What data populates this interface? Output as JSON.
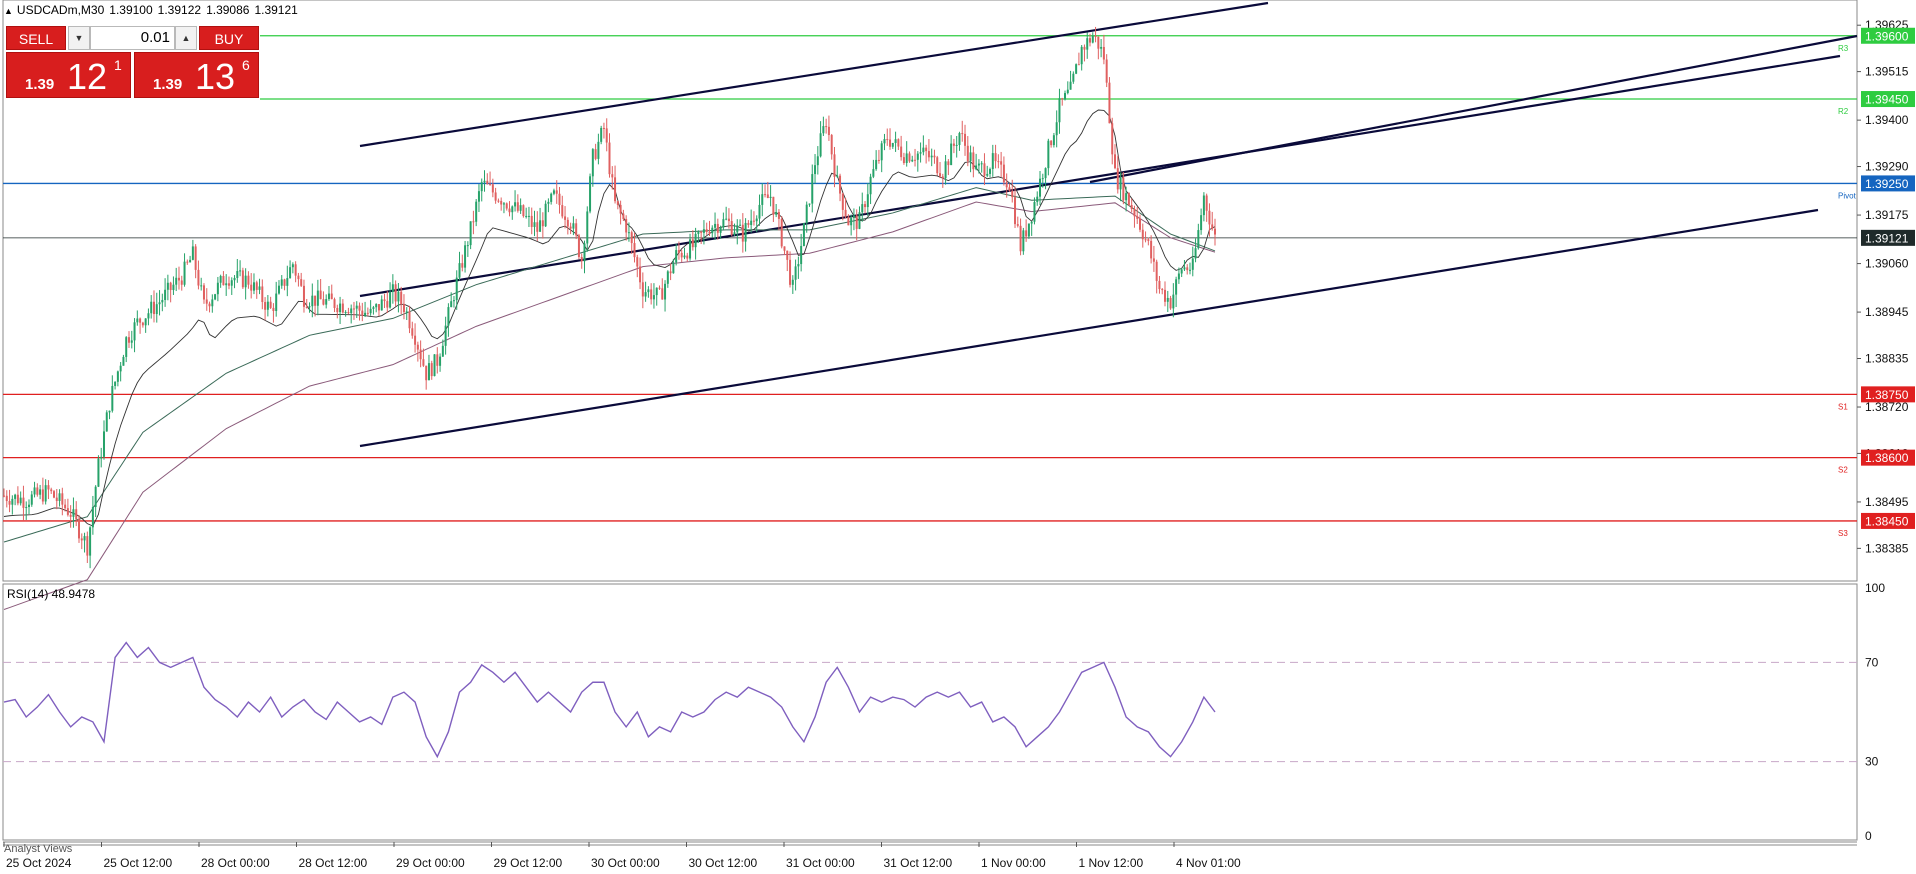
{
  "header": {
    "symbol": "USDCADm,M30",
    "ohlc": [
      "1.39100",
      "1.39122",
      "1.39086",
      "1.39121"
    ]
  },
  "trade_panel": {
    "sell_label": "SELL",
    "buy_label": "BUY",
    "lot_value": "0.01",
    "sell_price_small": "1.39",
    "sell_price_big": "12",
    "sell_price_sup": "1",
    "buy_price_small": "1.39",
    "buy_price_big": "13",
    "buy_price_sup": "6"
  },
  "rsi_label": "RSI(14) 48.9478",
  "footer_label": "Analyst Views",
  "colors": {
    "bull": "#26a269",
    "bear": "#e06060",
    "resistance": "#2ecc40",
    "support": "#e02020",
    "pivot": "#1565c0",
    "current": "#1f2a2a",
    "rsi": "#7f5fbf",
    "channel": "#0a0a3a"
  },
  "chart_data": [
    {
      "type": "candlestick",
      "symbol": "USDCADm",
      "timeframe": "M30",
      "ylim": [
        1.3831,
        1.3968
      ],
      "y_ticks": [
        1.39625,
        1.39515,
        1.394,
        1.3929,
        1.39175,
        1.3906,
        1.38945,
        1.38835,
        1.3872,
        1.3861,
        1.38495,
        1.38385
      ],
      "x_ticks": [
        "25 Oct 2024",
        "25 Oct 12:00",
        "28 Oct 00:00",
        "28 Oct 12:00",
        "29 Oct 00:00",
        "29 Oct 12:00",
        "30 Oct 00:00",
        "30 Oct 12:00",
        "31 Oct 00:00",
        "31 Oct 12:00",
        "1 Nov 00:00",
        "1 Nov 12:00",
        "4 Nov 01:00"
      ],
      "horizontal_levels": [
        {
          "label": "R3",
          "value": 1.396,
          "tag": "1.39600",
          "kind": "resistance"
        },
        {
          "label": "R2",
          "value": 1.3945,
          "tag": "1.39450",
          "kind": "resistance"
        },
        {
          "label": "Pivot",
          "value": 1.3925,
          "tag": "1.39250",
          "kind": "pivot"
        },
        {
          "label": "",
          "value": 1.39121,
          "tag": "1.39121",
          "kind": "current"
        },
        {
          "label": "S1",
          "value": 1.3875,
          "tag": "1.38750",
          "kind": "support"
        },
        {
          "label": "S2",
          "value": 1.386,
          "tag": "1.38600",
          "kind": "support"
        },
        {
          "label": "S3",
          "value": 1.3845,
          "tag": "1.38450",
          "kind": "support"
        }
      ],
      "close_path": [
        [
          0,
          1.3851
        ],
        [
          8,
          1.385
        ],
        [
          16,
          1.3852
        ],
        [
          24,
          1.3847
        ],
        [
          30,
          1.3839
        ],
        [
          34,
          1.3858
        ],
        [
          38,
          1.3873
        ],
        [
          44,
          1.3888
        ],
        [
          48,
          1.3892
        ],
        [
          56,
          1.3897
        ],
        [
          64,
          1.3903
        ],
        [
          68,
          1.3908
        ],
        [
          72,
          1.3896
        ],
        [
          80,
          1.3903
        ],
        [
          88,
          1.3902
        ],
        [
          96,
          1.3895
        ],
        [
          104,
          1.3906
        ],
        [
          108,
          1.3898
        ],
        [
          116,
          1.3897
        ],
        [
          124,
          1.3896
        ],
        [
          132,
          1.3894
        ],
        [
          140,
          1.3899
        ],
        [
          144,
          1.3896
        ],
        [
          148,
          1.3889
        ],
        [
          152,
          1.388
        ],
        [
          156,
          1.3883
        ],
        [
          162,
          1.3899
        ],
        [
          168,
          1.3914
        ],
        [
          172,
          1.3925
        ],
        [
          178,
          1.3922
        ],
        [
          186,
          1.3918
        ],
        [
          192,
          1.3914
        ],
        [
          198,
          1.3922
        ],
        [
          204,
          1.3916
        ],
        [
          208,
          1.3907
        ],
        [
          212,
          1.3931
        ],
        [
          216,
          1.3938
        ],
        [
          220,
          1.392
        ],
        [
          224,
          1.3915
        ],
        [
          230,
          1.39
        ],
        [
          236,
          1.3898
        ],
        [
          242,
          1.3908
        ],
        [
          248,
          1.391
        ],
        [
          254,
          1.3915
        ],
        [
          260,
          1.3916
        ],
        [
          266,
          1.3913
        ],
        [
          272,
          1.392
        ],
        [
          276,
          1.3922
        ],
        [
          280,
          1.3912
        ],
        [
          284,
          1.39
        ],
        [
          288,
          1.3914
        ],
        [
          292,
          1.393
        ],
        [
          296,
          1.394
        ],
        [
          300,
          1.3925
        ],
        [
          304,
          1.3916
        ],
        [
          308,
          1.3916
        ],
        [
          312,
          1.3926
        ],
        [
          318,
          1.3936
        ],
        [
          324,
          1.3932
        ],
        [
          328,
          1.3932
        ],
        [
          332,
          1.3932
        ],
        [
          338,
          1.3928
        ],
        [
          344,
          1.3937
        ],
        [
          350,
          1.3928
        ],
        [
          356,
          1.393
        ],
        [
          362,
          1.3925
        ],
        [
          366,
          1.391
        ],
        [
          370,
          1.3918
        ],
        [
          374,
          1.3928
        ],
        [
          380,
          1.3943
        ],
        [
          384,
          1.3947
        ],
        [
          388,
          1.3957
        ],
        [
          392,
          1.396
        ],
        [
          394,
          1.3958
        ],
        [
          396,
          1.3955
        ],
        [
          400,
          1.3927
        ],
        [
          404,
          1.3922
        ],
        [
          408,
          1.3917
        ],
        [
          412,
          1.391
        ],
        [
          416,
          1.39
        ],
        [
          420,
          1.3897
        ],
        [
          424,
          1.3905
        ],
        [
          428,
          1.3905
        ],
        [
          432,
          1.3922
        ],
        [
          436,
          1.3912
        ]
      ],
      "ma_path": [
        [
          0,
          1.384
        ],
        [
          30,
          1.3846
        ],
        [
          50,
          1.3866
        ],
        [
          80,
          1.388
        ],
        [
          110,
          1.3889
        ],
        [
          140,
          1.3893
        ],
        [
          170,
          1.3901
        ],
        [
          200,
          1.3907
        ],
        [
          230,
          1.3913
        ],
        [
          260,
          1.3914
        ],
        [
          290,
          1.3914
        ],
        [
          320,
          1.3918
        ],
        [
          350,
          1.3924
        ],
        [
          370,
          1.3921
        ],
        [
          400,
          1.3922
        ],
        [
          420,
          1.3913
        ],
        [
          436,
          1.3909
        ]
      ]
    },
    {
      "type": "line",
      "title": "RSI(14)",
      "value": 48.9478,
      "ylim": [
        0,
        100
      ],
      "y_ticks": [
        100,
        70,
        30,
        0
      ],
      "levels": [
        70,
        30
      ],
      "rsi_path": [
        [
          0,
          54
        ],
        [
          4,
          55
        ],
        [
          8,
          48
        ],
        [
          12,
          52
        ],
        [
          16,
          57
        ],
        [
          20,
          50
        ],
        [
          24,
          44
        ],
        [
          28,
          48
        ],
        [
          32,
          46
        ],
        [
          36,
          38
        ],
        [
          40,
          72
        ],
        [
          44,
          78
        ],
        [
          48,
          72
        ],
        [
          52,
          76
        ],
        [
          56,
          70
        ],
        [
          60,
          68
        ],
        [
          64,
          70
        ],
        [
          68,
          72
        ],
        [
          72,
          60
        ],
        [
          76,
          55
        ],
        [
          80,
          52
        ],
        [
          84,
          48
        ],
        [
          88,
          54
        ],
        [
          92,
          50
        ],
        [
          96,
          56
        ],
        [
          100,
          48
        ],
        [
          104,
          52
        ],
        [
          108,
          55
        ],
        [
          112,
          50
        ],
        [
          116,
          47
        ],
        [
          120,
          54
        ],
        [
          124,
          50
        ],
        [
          128,
          46
        ],
        [
          132,
          48
        ],
        [
          136,
          45
        ],
        [
          140,
          56
        ],
        [
          144,
          58
        ],
        [
          148,
          54
        ],
        [
          152,
          40
        ],
        [
          156,
          32
        ],
        [
          160,
          42
        ],
        [
          164,
          58
        ],
        [
          168,
          62
        ],
        [
          172,
          69
        ],
        [
          176,
          66
        ],
        [
          180,
          62
        ],
        [
          184,
          66
        ],
        [
          188,
          60
        ],
        [
          192,
          54
        ],
        [
          196,
          58
        ],
        [
          200,
          54
        ],
        [
          204,
          50
        ],
        [
          208,
          58
        ],
        [
          212,
          62
        ],
        [
          216,
          62
        ],
        [
          220,
          50
        ],
        [
          224,
          44
        ],
        [
          228,
          50
        ],
        [
          232,
          40
        ],
        [
          236,
          44
        ],
        [
          240,
          42
        ],
        [
          244,
          50
        ],
        [
          248,
          48
        ],
        [
          252,
          50
        ],
        [
          256,
          55
        ],
        [
          260,
          58
        ],
        [
          264,
          56
        ],
        [
          268,
          60
        ],
        [
          272,
          58
        ],
        [
          276,
          56
        ],
        [
          280,
          52
        ],
        [
          284,
          44
        ],
        [
          288,
          38
        ],
        [
          292,
          48
        ],
        [
          296,
          62
        ],
        [
          300,
          68
        ],
        [
          304,
          60
        ],
        [
          308,
          50
        ],
        [
          312,
          56
        ],
        [
          316,
          54
        ],
        [
          320,
          56
        ],
        [
          324,
          55
        ],
        [
          328,
          52
        ],
        [
          332,
          56
        ],
        [
          336,
          58
        ],
        [
          340,
          56
        ],
        [
          344,
          58
        ],
        [
          348,
          52
        ],
        [
          352,
          54
        ],
        [
          356,
          46
        ],
        [
          360,
          48
        ],
        [
          364,
          44
        ],
        [
          368,
          36
        ],
        [
          372,
          40
        ],
        [
          376,
          44
        ],
        [
          380,
          50
        ],
        [
          384,
          58
        ],
        [
          388,
          66
        ],
        [
          392,
          68
        ],
        [
          396,
          70
        ],
        [
          400,
          60
        ],
        [
          404,
          48
        ],
        [
          408,
          44
        ],
        [
          412,
          42
        ],
        [
          416,
          36
        ],
        [
          420,
          32
        ],
        [
          424,
          38
        ],
        [
          428,
          46
        ],
        [
          432,
          56
        ],
        [
          436,
          50
        ]
      ]
    }
  ]
}
